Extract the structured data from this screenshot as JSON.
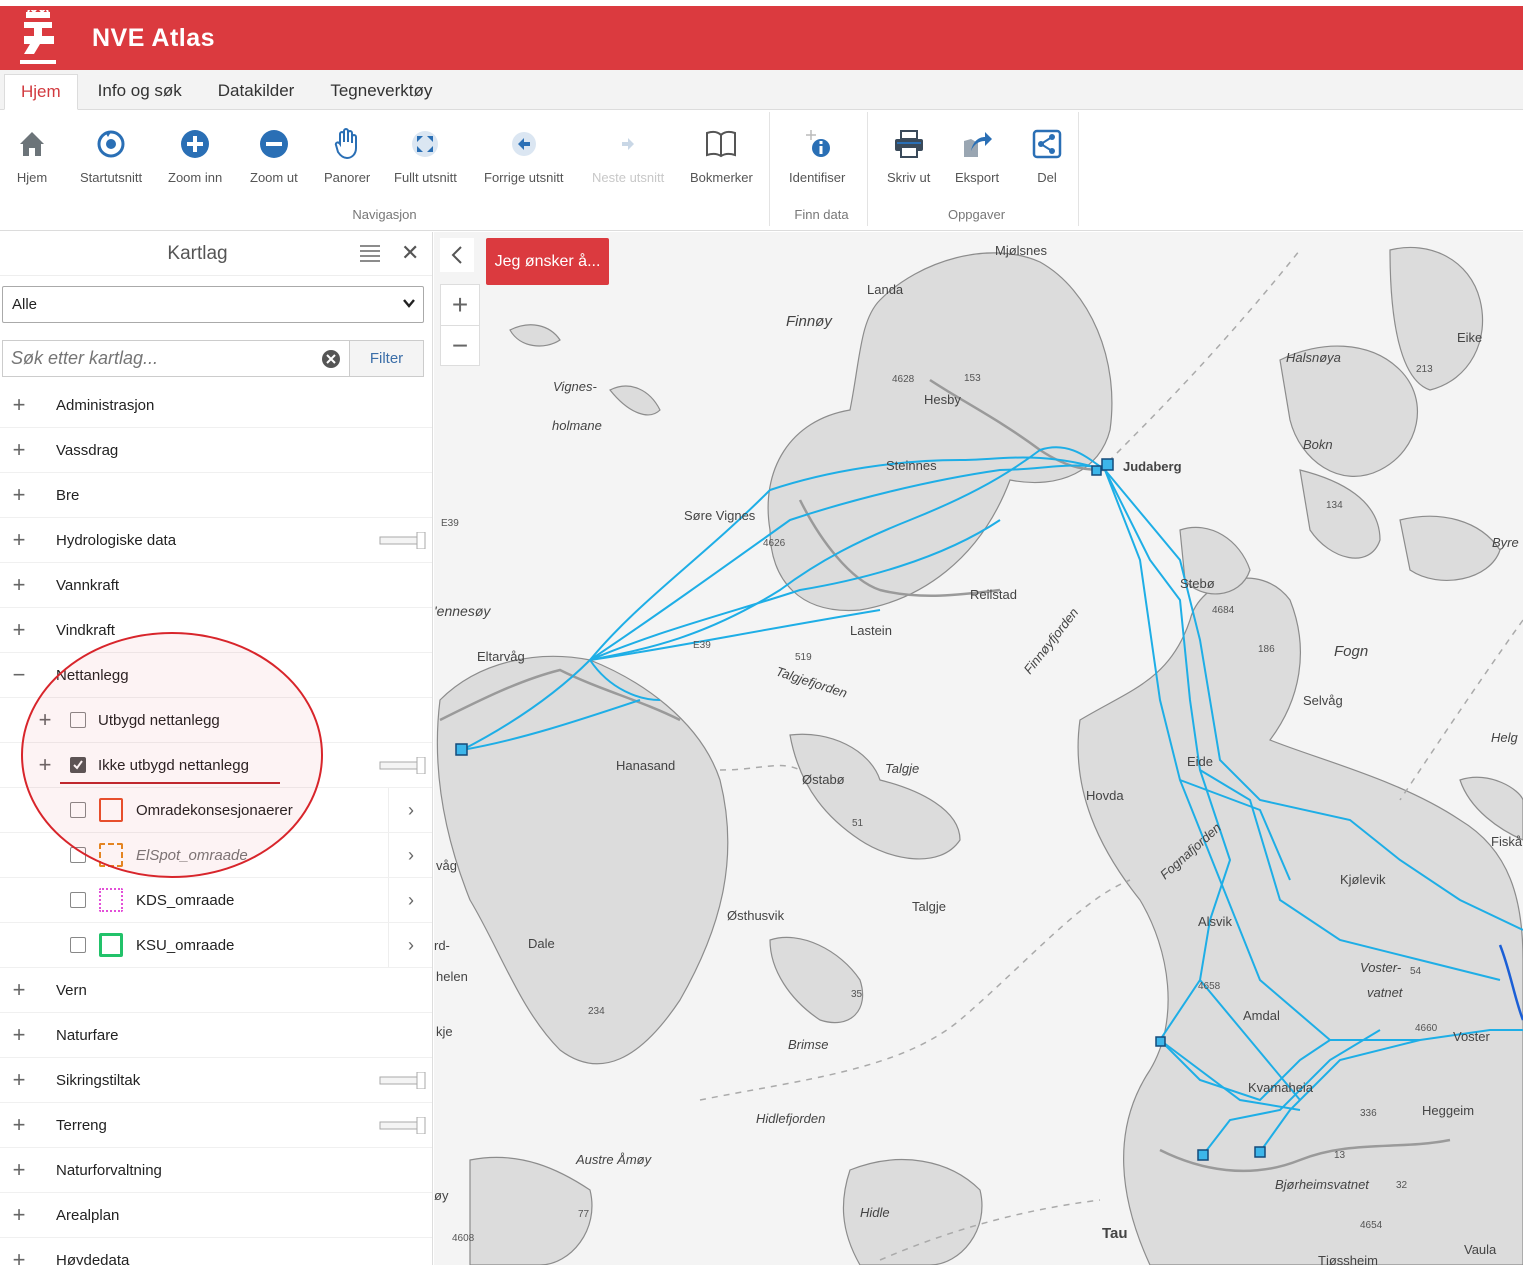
{
  "app": {
    "title": "NVE Atlas"
  },
  "tabs": [
    {
      "label": "Hjem",
      "active": true
    },
    {
      "label": "Info og søk"
    },
    {
      "label": "Datakilder"
    },
    {
      "label": "Tegneverktøy"
    }
  ],
  "ribbon": {
    "navigasjon": {
      "label": "Navigasjon",
      "buttons": [
        {
          "label": "Hjem",
          "icon": "home-icon"
        },
        {
          "label": "Startutsnitt",
          "icon": "refresh-icon"
        },
        {
          "label": "Zoom inn",
          "icon": "zoom-in-icon"
        },
        {
          "label": "Zoom ut",
          "icon": "zoom-out-icon"
        },
        {
          "label": "Panorer",
          "icon": "hand-icon"
        },
        {
          "label": "Fullt utsnitt",
          "icon": "full-extent-icon"
        },
        {
          "label": "Forrige utsnitt",
          "icon": "back-arrow-icon"
        },
        {
          "label": "Neste utsnitt",
          "icon": "forward-arrow-icon",
          "disabled": true
        },
        {
          "label": "Bokmerker",
          "icon": "book-icon"
        }
      ]
    },
    "finn_data": {
      "label": "Finn data",
      "buttons": [
        {
          "label": "Identifiser",
          "icon": "identify-icon"
        }
      ]
    },
    "oppgaver": {
      "label": "Oppgaver",
      "buttons": [
        {
          "label": "Skriv ut",
          "icon": "print-icon"
        },
        {
          "label": "Eksport",
          "icon": "export-icon"
        },
        {
          "label": "Del",
          "icon": "share-icon"
        }
      ]
    }
  },
  "panel": {
    "title": "Kartlag",
    "filter_select": "Alle",
    "search_placeholder": "Søk etter kartlag...",
    "filter_button": "Filter",
    "layers": {
      "administrasjon": "Administrasjon",
      "vassdrag": "Vassdrag",
      "bre": "Bre",
      "hydrologiske": "Hydrologiske data",
      "vannkraft": "Vannkraft",
      "vindkraft": "Vindkraft",
      "nettanlegg": "Nettanlegg",
      "utbygd": "Utbygd nettanlegg",
      "ikke_utbygd": "Ikke utbygd nettanlegg",
      "omradekonsesjonaerer": "Omradekonsesjonaerer",
      "elspot": "ElSpot_omraade",
      "kds": "KDS_omraade",
      "ksu": "KSU_omraade",
      "vern": "Vern",
      "naturfare": "Naturfare",
      "sikringstiltak": "Sikringstiltak",
      "terreng": "Terreng",
      "naturforvaltning": "Naturforvaltning",
      "arealplan": "Arealplan",
      "hoydedata": "Høydedata"
    },
    "colors": {
      "omradekonsesjonaerer": "#e8502b",
      "elspot": "#e58a1f",
      "kds": "#e34fd8",
      "ksu": "#22c26a"
    }
  },
  "map": {
    "wish_button": "Jeg ønsker å...",
    "line_color": "#1eaee6",
    "places": {
      "mjolsnes": "Mjølsnes",
      "landa": "Landa",
      "finnoy": "Finnøy",
      "eike": "Eike",
      "halsnoya": "Halsnøya",
      "vignes": "Vignes-",
      "holmane": "holmane",
      "hesby": "Hesby",
      "bokn": "Bokn",
      "judaberg": "Judaberg",
      "steinnes": "Steinnes",
      "sore_vignes": "Søre Vignes",
      "byre": "Byre",
      "ennesoy": "'ennesøy",
      "reilstad": "Reilstad",
      "stebo": "Stebø",
      "lastein": "Lastein",
      "finnoyfjorden": "Finnøyfjorden",
      "eltarvag": "Eltarvåg",
      "talgjefjorden": "Talgjefjorden",
      "fogn": "Fogn",
      "selvag": "Selvåg",
      "helg": "Helg",
      "hanasand": "Hanasand",
      "ostabo": "Østabø",
      "talgje_it": "Talgje",
      "eide": "Eide",
      "hovda": "Hovda",
      "fiska": "Fiskå",
      "fognafjorden": "Fognafjorden",
      "kjolevik": "Kjølevik",
      "vag": "våg",
      "osthusvik": "Østhusvik",
      "talgje": "Talgje",
      "alsvik": "Alsvik",
      "dale": "Dale",
      "rd": "rd-",
      "helen": "helen",
      "voster": "Voster-",
      "vatnet": "vatnet",
      "kje": "kje",
      "brimse": "Brimse",
      "amdal": "Amdal",
      "vosterplace": "Voster",
      "kvamaheia": "Kvamaheia",
      "heggeim": "Heggeim",
      "hidlefjorden": "Hidlefjorden",
      "austre_amoy": "Austre Åmøy",
      "bjorheimsvatnet": "Bjørheimsvatnet",
      "hidle": "Hidle",
      "tau": "Tau",
      "vaula": "Vaula",
      "oy": "øy",
      "tjossheim": "Tjøssheim"
    },
    "numbers": {
      "n4628": "4628",
      "n153": "153",
      "n213": "213",
      "n134": "134",
      "n4626": "4626",
      "n4684": "4684",
      "n186": "186",
      "n519": "519",
      "n51": "51",
      "n234": "234",
      "n35": "35",
      "n4658": "4658",
      "n54": "54",
      "n4660": "4660",
      "n336": "336",
      "n13": "13",
      "n32": "32",
      "n77": "77",
      "n4654": "4654",
      "n4608": "4608",
      "e39a": "E39",
      "e39b": "E39"
    }
  }
}
